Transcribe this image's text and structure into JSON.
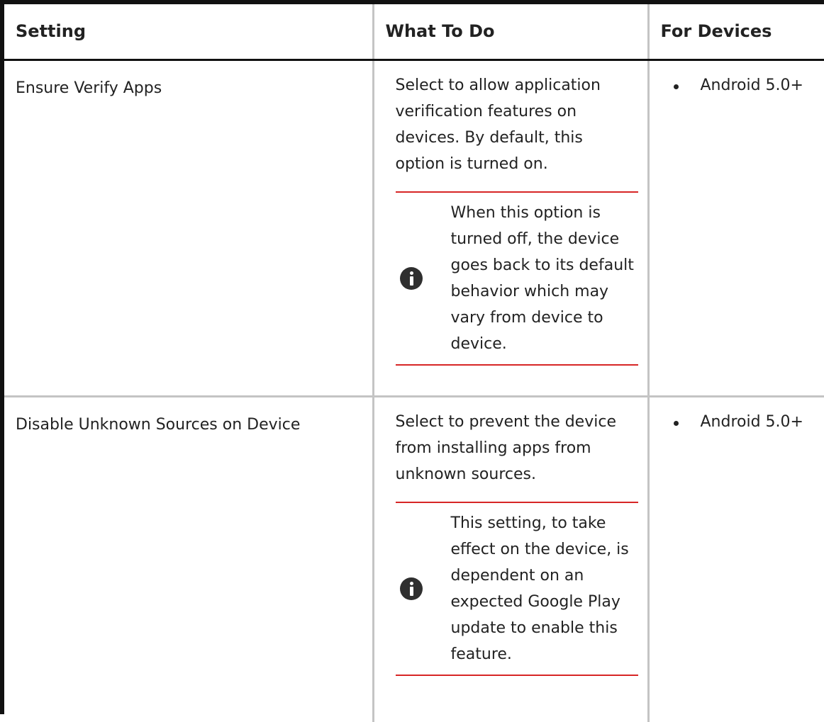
{
  "table": {
    "headers": {
      "setting": "Setting",
      "what": "What To Do",
      "devices": "For Devices"
    },
    "rows": [
      {
        "setting": "Ensure Verify Apps",
        "what": "Select to allow application verification features on devices. By default, this option is turned on.",
        "note_icon": "info-icon",
        "note": "When this option is turned off, the device goes back to its default behavior which may vary from device to device.",
        "devices": [
          "Android 5.0+"
        ]
      },
      {
        "setting": "Disable Unknown Sources on Device",
        "what": "Select to prevent the device from installing apps from unknown sources.",
        "note_icon": "info-icon",
        "note": "This setting, to take effect on the device, is dependent on an expected Google Play update to enable this feature.",
        "devices": [
          "Android 5.0+"
        ]
      }
    ]
  },
  "colors": {
    "note_border": "#d72626",
    "grid": "#c4c4c4",
    "frame": "#111111"
  }
}
